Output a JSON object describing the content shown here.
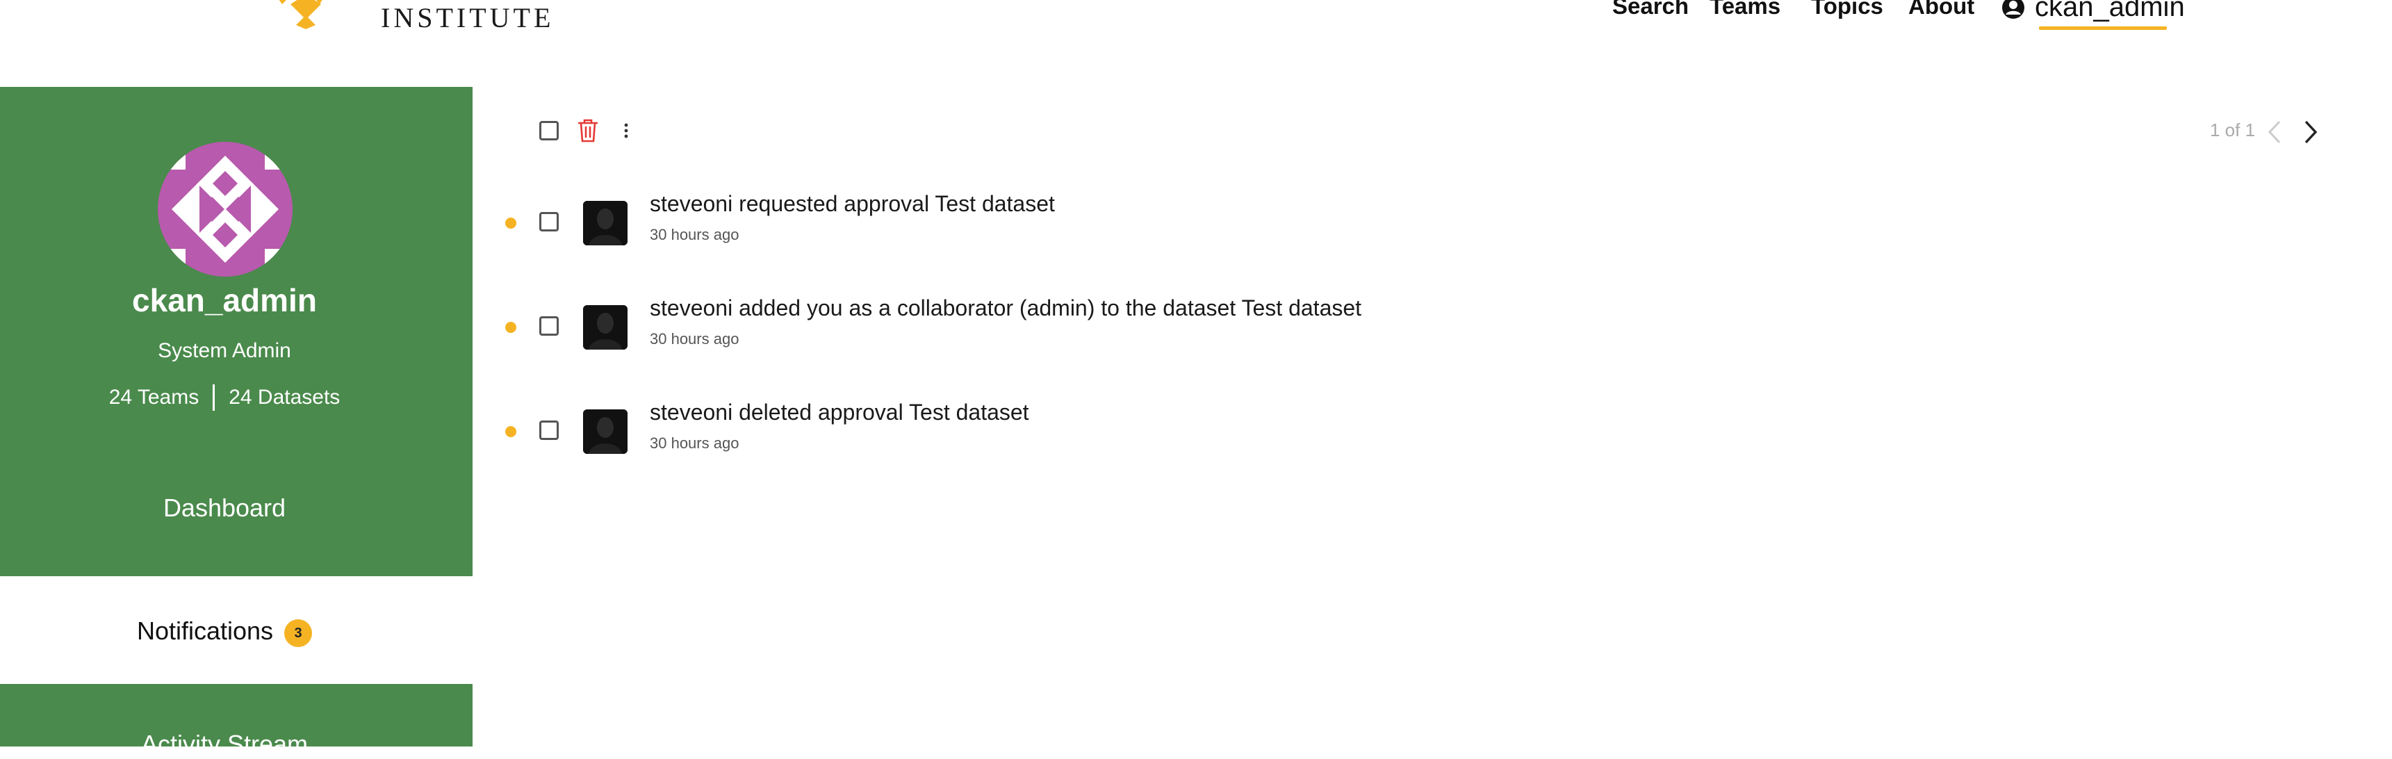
{
  "header": {
    "brand": "INSTITUTE",
    "nav": [
      "Search",
      "Teams",
      "Topics",
      "About"
    ],
    "user_label": "ckan_admin",
    "accent_color": "#f5b324"
  },
  "sidebar": {
    "username": "ckan_admin",
    "role": "System Admin",
    "teams_count": "24 Teams",
    "datasets_count": "24 Datasets",
    "links": {
      "dashboard": "Dashboard",
      "notifications": "Notifications",
      "notifications_badge": "3",
      "activity_stream": "Activity Stream"
    },
    "background_color": "#4a8a4c"
  },
  "toolbar": {
    "select_all_icon": "checkbox-icon",
    "delete_icon": "trash-icon",
    "more_icon": "kebab-menu-icon",
    "pagination": "1 of 1"
  },
  "notifications": [
    {
      "title": "steveoni requested approval Test dataset",
      "time": "30 hours ago"
    },
    {
      "title": "steveoni added you as a collaborator (admin) to the dataset Test dataset",
      "time": "30 hours ago"
    },
    {
      "title": "steveoni deleted approval Test dataset",
      "time": "30 hours ago"
    }
  ]
}
